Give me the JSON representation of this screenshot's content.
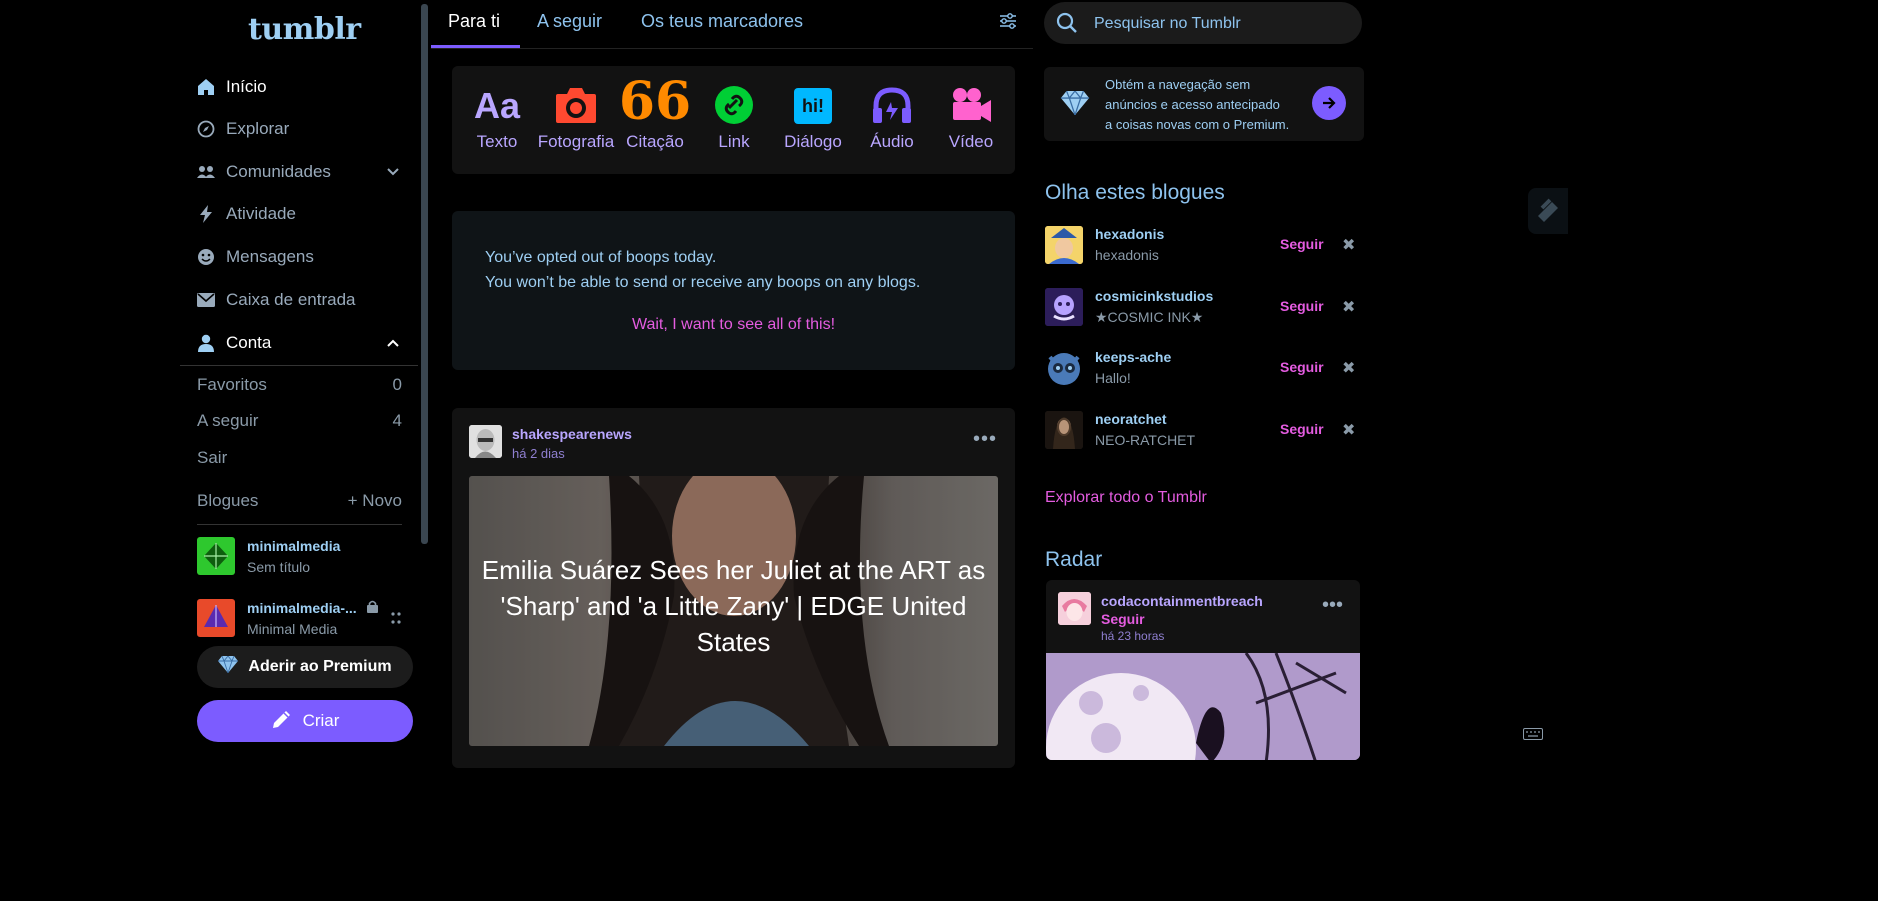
{
  "app": {
    "logo": "tumblr"
  },
  "sidebar": {
    "nav": [
      {
        "label": "Início",
        "icon": "home-icon"
      },
      {
        "label": "Explorar",
        "icon": "compass-icon"
      },
      {
        "label": "Comunidades",
        "icon": "people-icon"
      },
      {
        "label": "Atividade",
        "icon": "lightning-icon"
      },
      {
        "label": "Mensagens",
        "icon": "smiley-icon"
      },
      {
        "label": "Caixa de entrada",
        "icon": "envelope-icon"
      },
      {
        "label": "Conta",
        "icon": "user-icon"
      }
    ],
    "account": {
      "likes_label": "Favoritos",
      "likes_count": "0",
      "following_label": "A seguir",
      "following_count": "4",
      "logout_label": "Sair",
      "blogs_label": "Blogues",
      "new_blog_label": "+ Novo"
    },
    "blogs": [
      {
        "name": "minimalmedia",
        "title": "Sem título"
      },
      {
        "name": "minimalmedia-...",
        "title": "Minimal Media"
      }
    ],
    "premium_label": "Aderir ao Premium",
    "create_label": "Criar"
  },
  "feed": {
    "tabs": [
      "Para ti",
      "A seguir",
      "Os teus marcadores"
    ],
    "active_tab": "Para ti",
    "post_types": [
      {
        "label": "Texto",
        "color": "#b9a6ff"
      },
      {
        "label": "Fotografia",
        "color": "#ff4930"
      },
      {
        "label": "Citação",
        "color": "#ff8a00"
      },
      {
        "label": "Link",
        "color": "#00cf35"
      },
      {
        "label": "Diálogo",
        "color": "#00b8ff"
      },
      {
        "label": "Áudio",
        "color": "#7c5cff"
      },
      {
        "label": "Vídeo",
        "color": "#ff62ce"
      }
    ],
    "text_glyph": "Aa",
    "quote_glyph": "66",
    "dialog_glyph": "hi!",
    "boops": {
      "line1": "You’ve opted out of boops today.",
      "line2": "You won’t be able to send or receive any boops on any blogs.",
      "link": "Wait, I want to see all of this!"
    },
    "post": {
      "blog": "shakespearenews",
      "time": "há 2 dias",
      "headline": "Emilia Suárez Sees her Juliet at the ART as 'Sharp' and 'a Little Zany' | EDGE United States"
    }
  },
  "right": {
    "search_placeholder": "Pesquisar no Tumblr",
    "promo_text": "Obtém a navegação sem anúncios e acesso antecipado a coisas novas com o Premium.",
    "recommended_heading": "Olha estes blogues",
    "follow_label": "Seguir",
    "recommended": [
      {
        "name": "hexadonis",
        "title": "hexadonis"
      },
      {
        "name": "cosmicinkstudios",
        "title": "★COSMIC INK★"
      },
      {
        "name": "keeps-ache",
        "title": "Hallo!"
      },
      {
        "name": "neoratchet",
        "title": "NEO-RATCHET"
      }
    ],
    "explore_all": "Explorar todo o Tumblr",
    "radar_heading": "Radar",
    "radar": {
      "blog": "codacontainmentbreach",
      "follow": "Seguir",
      "time": "há 23 horas"
    }
  },
  "colors": {
    "accent": "#7c5cff",
    "link_pink": "#e45ce0",
    "text_blue": "#9ecff3",
    "background": "#000000"
  }
}
